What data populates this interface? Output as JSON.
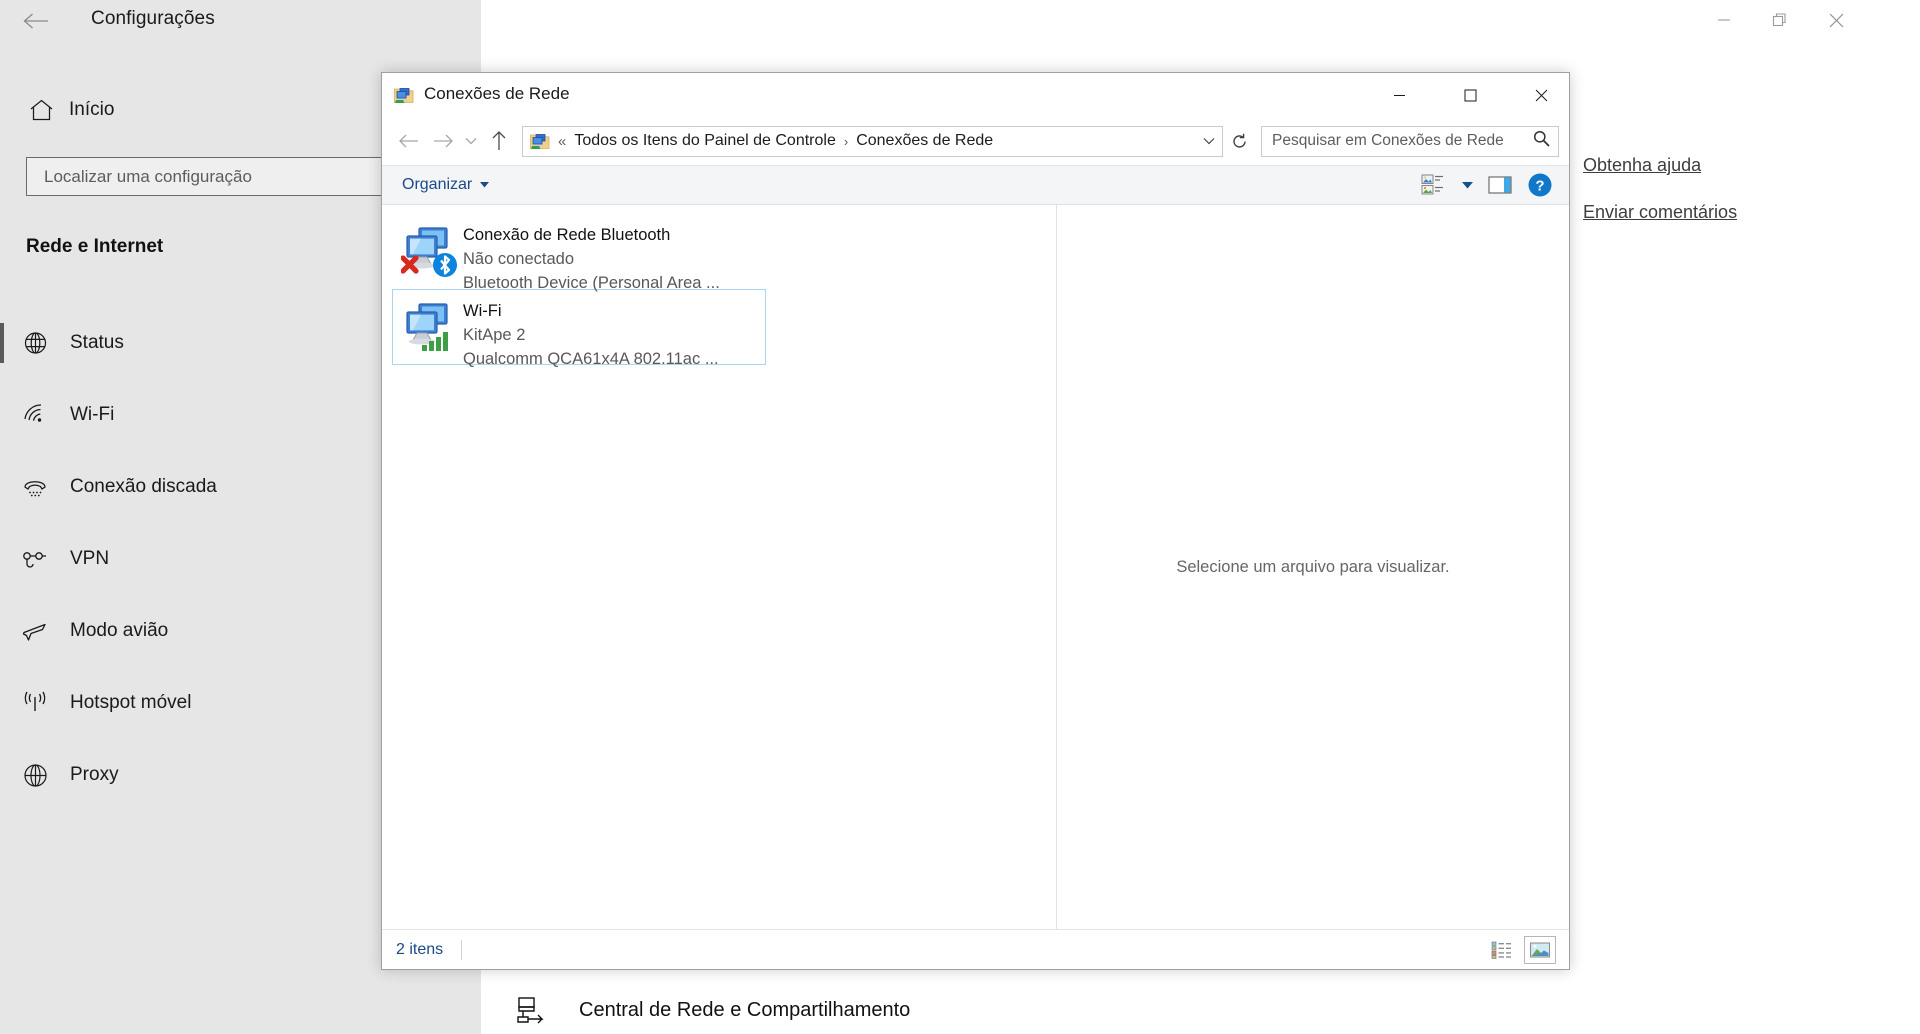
{
  "settings": {
    "window_title": "Configurações",
    "back_icon": "back-arrow-icon",
    "controls": {
      "minimize": "minimize-icon",
      "restore": "restore-icon",
      "close": "close-icon"
    },
    "home_label": "Início",
    "search_placeholder": "Localizar uma configuração",
    "search_value": "",
    "section_title": "Rede e Internet",
    "nav_items": [
      {
        "label": "Status",
        "icon": "globe-status-icon",
        "selected": true
      },
      {
        "label": "Wi-Fi",
        "icon": "wifi-icon",
        "selected": false
      },
      {
        "label": "Conexão discada",
        "icon": "dialup-phone-icon",
        "selected": false
      },
      {
        "label": "VPN",
        "icon": "vpn-icon",
        "selected": false
      },
      {
        "label": "Modo avião",
        "icon": "airplane-icon",
        "selected": false
      },
      {
        "label": "Hotspot móvel",
        "icon": "hotspot-icon",
        "selected": false
      },
      {
        "label": "Proxy",
        "icon": "globe-icon",
        "selected": false
      }
    ],
    "links": [
      {
        "label": "Obtenha ajuda"
      },
      {
        "label": "Enviar comentários"
      }
    ],
    "network_center": {
      "label": "Central de Rede e Compartilhamento",
      "icon": "network-sharing-icon"
    }
  },
  "explorer": {
    "title": "Conexões de Rede",
    "title_icon": "network-connections-icon",
    "controls": {
      "minimize": "minimize-icon",
      "maximize": "maximize-icon",
      "close": "close-icon"
    },
    "nav": {
      "back": "back-arrow-icon",
      "forward": "forward-arrow-icon",
      "recent": "chevron-down-icon",
      "up": "up-arrow-icon"
    },
    "address": {
      "icon": "network-connections-icon",
      "overflow": "«",
      "crumbs": [
        "Todos os Itens do Painel de Controle",
        "Conexões de Rede"
      ],
      "separator": "›",
      "dropdown": "chevron-down-icon",
      "refresh": "refresh-icon"
    },
    "search": {
      "placeholder": "Pesquisar em Conexões de Rede",
      "value": "",
      "icon": "search-icon"
    },
    "command_bar": {
      "organize_label": "Organizar",
      "organize_caret": "chevron-down-icon",
      "view_options_icon": "change-view-icon",
      "view_options_caret": "chevron-down-icon",
      "preview_pane_icon": "preview-pane-icon",
      "help_icon": "help-icon"
    },
    "items": [
      {
        "name": "Conexão de Rede Bluetooth",
        "status": "Não conectado",
        "device": "Bluetooth Device (Personal Area ...",
        "icon": "network-adapter-icon",
        "badge": "bluetooth-badge-icon",
        "error_badge": "red-x-icon",
        "selected": false
      },
      {
        "name": "Wi-Fi",
        "status": "KitApe 2",
        "device": "Qualcomm QCA61x4A 802.11ac ...",
        "icon": "network-adapter-icon",
        "badge": "signal-bars-icon",
        "error_badge": "",
        "selected": true
      }
    ],
    "preview": {
      "empty_text": "Selecione um arquivo para visualizar."
    },
    "status_bar": {
      "count_label": "2 itens",
      "details_view_icon": "details-view-icon",
      "large_icons_view_icon": "large-icons-view-icon"
    }
  },
  "colors": {
    "settings_sidebar": "#e6e6e6",
    "accent_link": "#1b4a87",
    "selection_border": "#a8d5f2",
    "command_bar_bg": "#f4f5f7"
  }
}
